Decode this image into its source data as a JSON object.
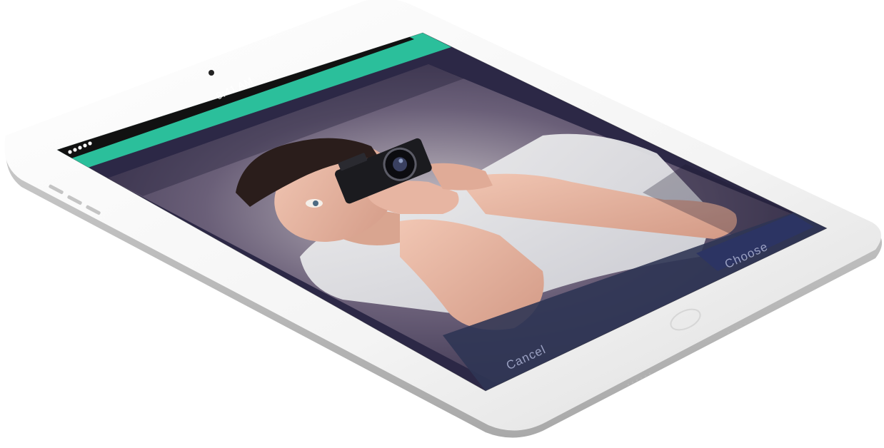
{
  "status_bar": {
    "time": "9:41 AM",
    "signal_dots": 5
  },
  "toolbar": {
    "cancel_label": "Cancel",
    "choose_label": "Choose"
  },
  "colors": {
    "header_accent": "#2bbf9b",
    "screen_background": "#2c2846",
    "bottom_bar": "#2f3554",
    "device_frame": "#f3f3f3",
    "status_bar_background": "#111111"
  },
  "icons": {
    "camera_front": "front-camera-icon",
    "home_button": "home-button-icon",
    "battery": "battery-icon"
  }
}
